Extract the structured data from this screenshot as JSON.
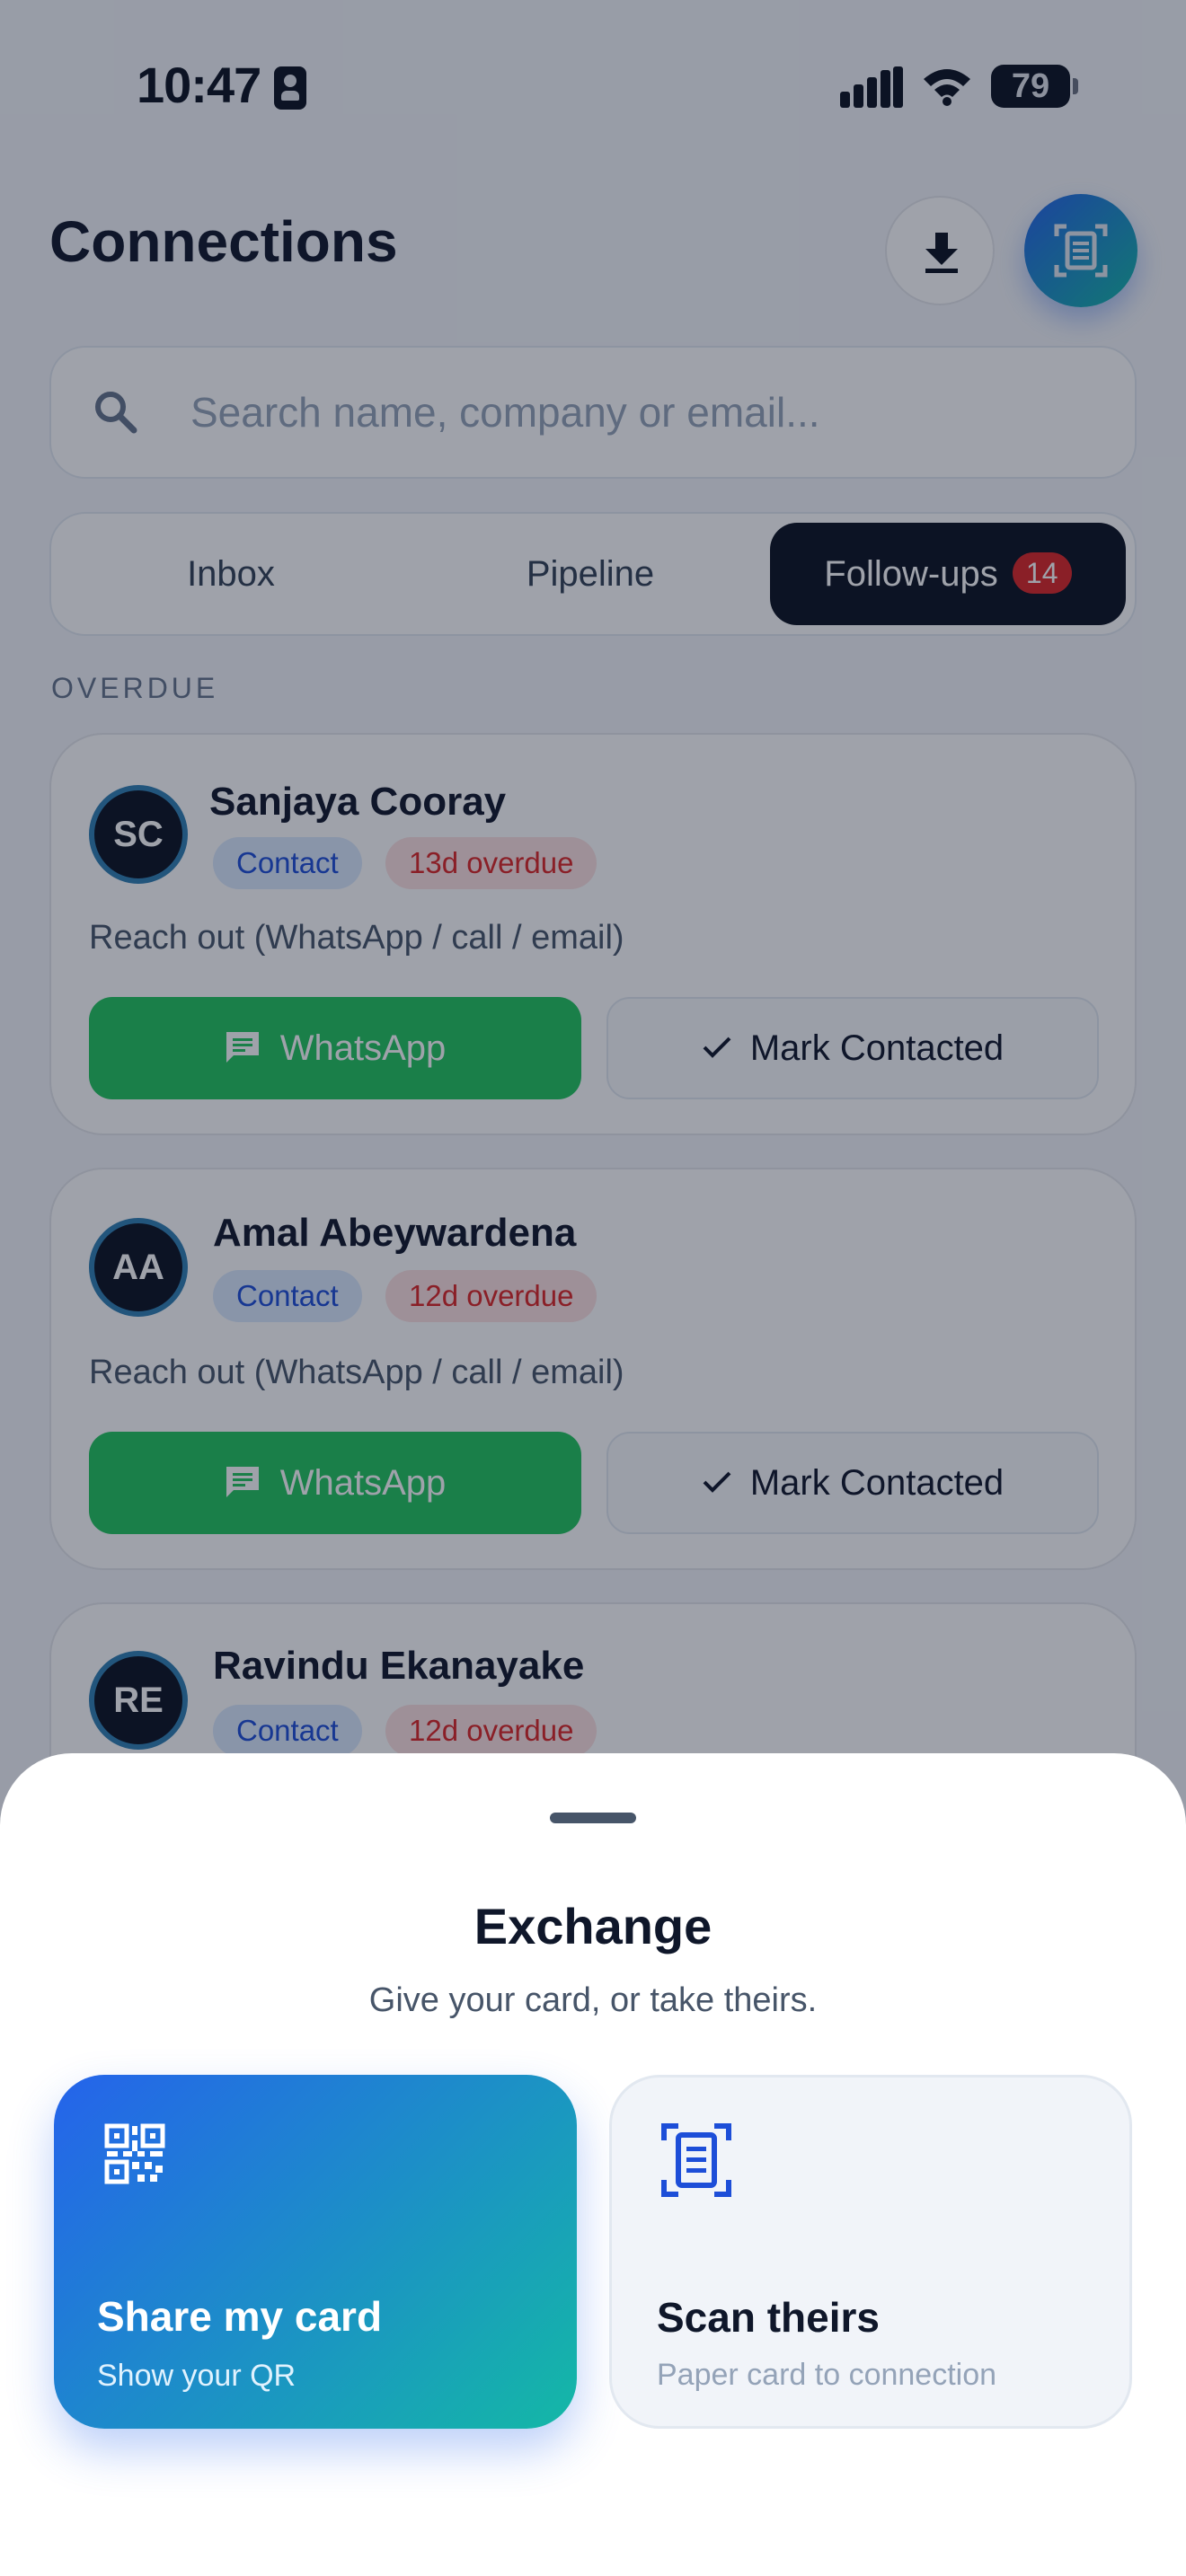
{
  "status_bar": {
    "time": "10:47",
    "battery": "79"
  },
  "header": {
    "title": "Connections"
  },
  "search": {
    "placeholder": "Search name, company or email..."
  },
  "tabs": [
    {
      "label": "Inbox"
    },
    {
      "label": "Pipeline"
    },
    {
      "label": "Follow-ups",
      "count": "14"
    }
  ],
  "section": {
    "label": "OVERDUE"
  },
  "contacts": [
    {
      "initials": "SC",
      "name": "Sanjaya Cooray",
      "tag": "Contact",
      "overdue": "13d overdue",
      "note": "Reach out (WhatsApp / call / email)",
      "primary_action": "WhatsApp",
      "secondary_action": "Mark Contacted"
    },
    {
      "initials": "AA",
      "name": "Amal Abeywardena",
      "tag": "Contact",
      "overdue": "12d overdue",
      "note": "Reach out (WhatsApp / call / email)",
      "primary_action": "WhatsApp",
      "secondary_action": "Mark Contacted"
    },
    {
      "initials": "RE",
      "name": "Ravindu Ekanayake",
      "tag": "Contact",
      "overdue": "12d overdue"
    }
  ],
  "sheet": {
    "title": "Exchange",
    "subtitle": "Give your card, or take theirs.",
    "options": [
      {
        "title": "Share my card",
        "subtitle": "Show your QR",
        "icon": "qr-code-icon"
      },
      {
        "title": "Scan theirs",
        "subtitle": "Paper card to connection",
        "icon": "document-scanner-icon"
      }
    ]
  },
  "colors": {
    "accent_start": "#2563eb",
    "accent_end": "#14b8a6",
    "whatsapp": "#22c55e",
    "overdue": "#dc2626",
    "dark": "#0b1220"
  }
}
